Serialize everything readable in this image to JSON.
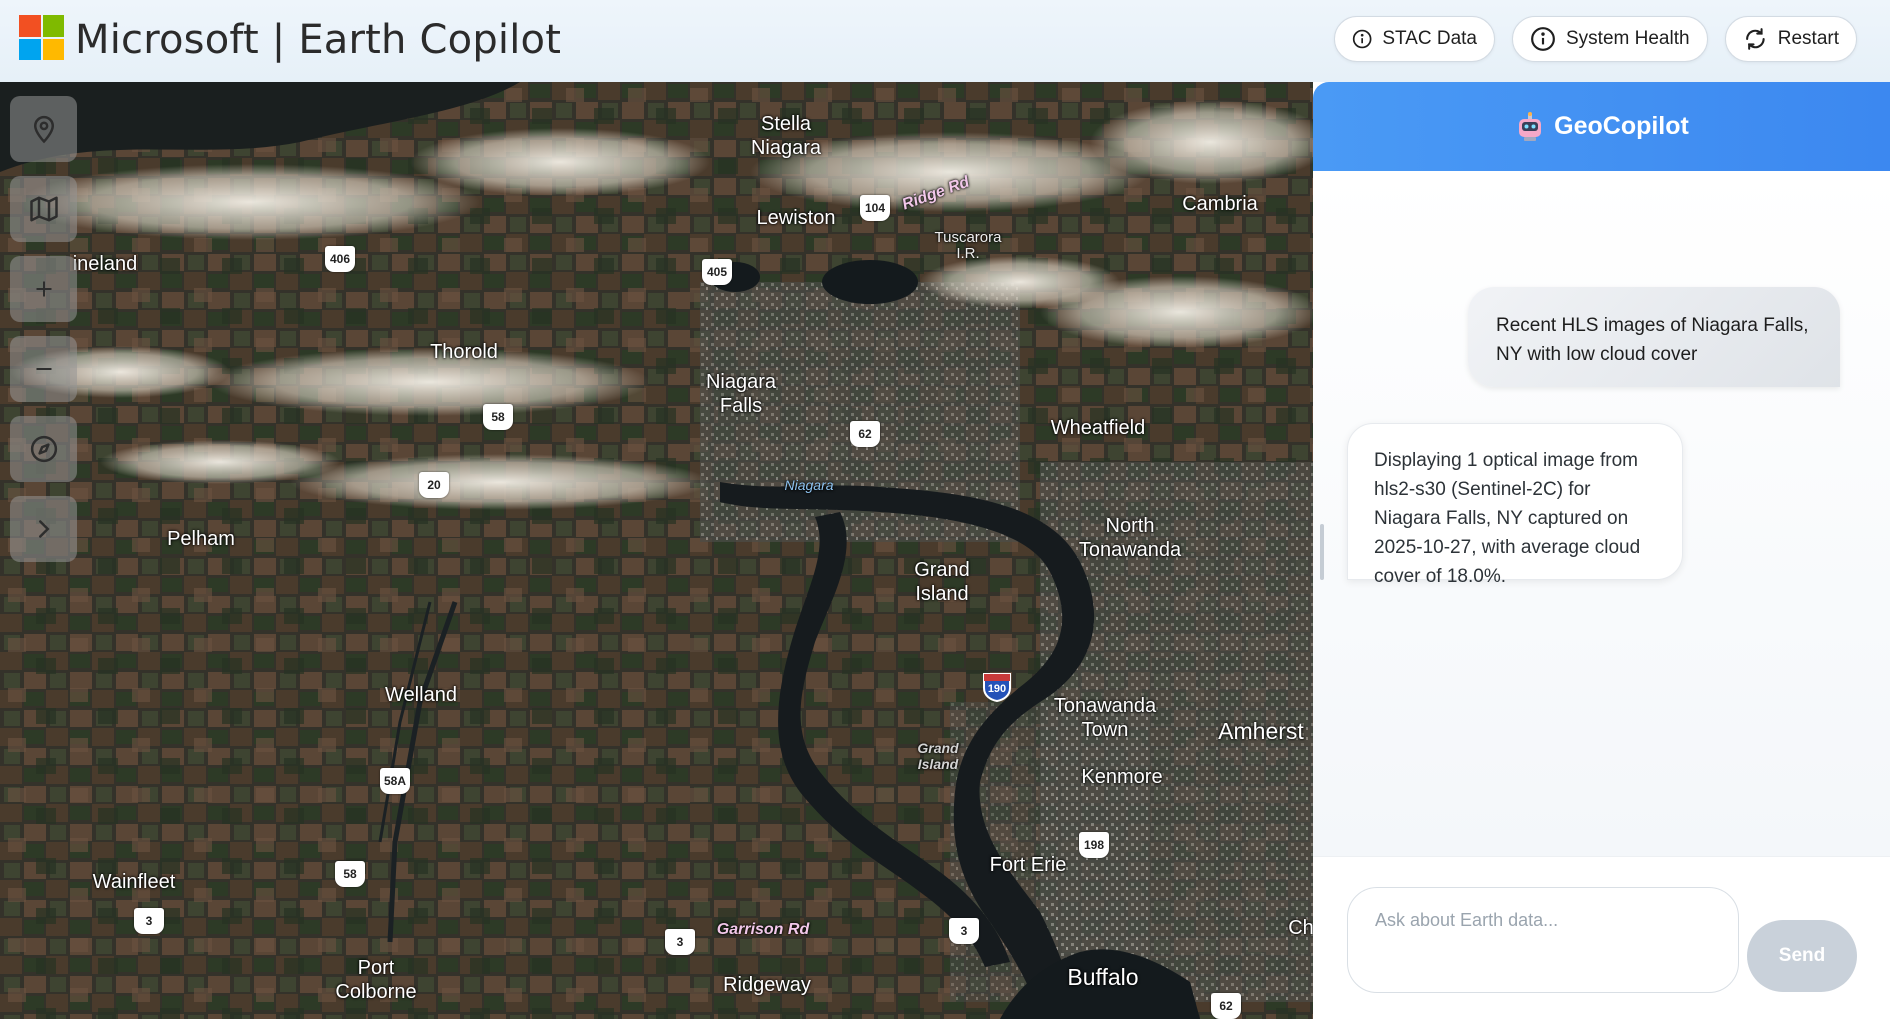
{
  "header": {
    "app_title": "Microsoft | Earth Copilot",
    "logo_colors": [
      "#f25022",
      "#7fba00",
      "#00a4ef",
      "#ffb900"
    ],
    "buttons": [
      {
        "label": "STAC Data",
        "icon": "info-icon"
      },
      {
        "label": "System Health",
        "icon": "info-icon"
      },
      {
        "label": "Restart",
        "icon": "refresh-icon"
      }
    ]
  },
  "map": {
    "tools": [
      {
        "name": "location-pin-icon"
      },
      {
        "name": "map-icon"
      },
      {
        "name": "zoom-in-icon",
        "glyph": "+"
      },
      {
        "name": "zoom-out-icon",
        "glyph": "−"
      },
      {
        "name": "compass-icon"
      },
      {
        "name": "chevron-right-icon"
      }
    ],
    "places": {
      "stella_niagara": "Stella\nNiagara",
      "lewiston": "Lewiston",
      "ridge_rd": "Ridge Rd",
      "tuscarora": "Tuscarora\nI.R.",
      "cambria": "Cambria",
      "vineland": "ineland",
      "thorold": "Thorold",
      "niagara_falls": "Niagara\nFalls",
      "wheatfield": "Wheatfield",
      "niagara_river": "Niagara",
      "pelham": "Pelham",
      "north_tonawanda": "North\nTonawanda",
      "grand_island": "Grand\nIsland",
      "grand_island_italic": "Grand\nIsland",
      "welland": "Welland",
      "tonawanda_town": "Tonawanda\nTown",
      "amherst": "Amherst",
      "kenmore": "Kenmore",
      "wainfleet": "Wainfleet",
      "fort_erie": "Fort Erie",
      "port_colborne": "Port\nColborne",
      "garrison_rd": "Garrison Rd",
      "ridgeway": "Ridgeway",
      "buffalo": "Buffalo",
      "ch": "Ch"
    },
    "shields": [
      "406",
      "405",
      "104",
      "58",
      "62",
      "20",
      "58A",
      "58",
      "3",
      "3",
      "3",
      "198",
      "62"
    ],
    "interstate": "190"
  },
  "chat": {
    "title": "GeoCopilot",
    "messages": [
      {
        "role": "user",
        "text": "Recent HLS images of Niagara Falls, NY with low cloud cover"
      },
      {
        "role": "assistant",
        "text": "Displaying 1 optical image from hls2-s30 (Sentinel-2C) for Niagara Falls, NY captured on 2025-10-27, with average cloud cover of 18.0%."
      }
    ],
    "input_placeholder": "Ask about Earth data...",
    "send_label": "Send"
  }
}
